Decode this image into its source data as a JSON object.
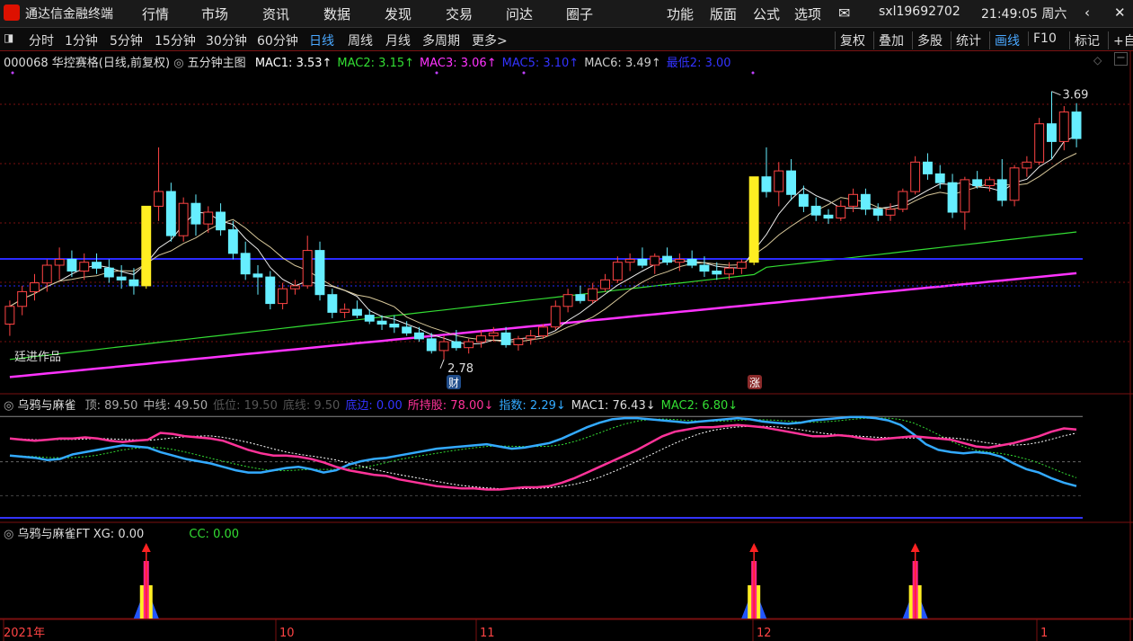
{
  "app": {
    "title": "通达信金融终端",
    "menu": [
      "行情",
      "市场",
      "资讯",
      "数据",
      "发现",
      "交易",
      "问达",
      "圈子"
    ],
    "right_menu": [
      "功能",
      "版面",
      "公式",
      "选项"
    ],
    "user": "sxl19692702",
    "clock": "21:49:05 周六"
  },
  "toolbar": {
    "periods": [
      "分时",
      "1分钟",
      "5分钟",
      "15分钟",
      "30分钟",
      "60分钟",
      "日线",
      "周线",
      "月线",
      "多周期",
      "更多>"
    ],
    "active": "日线",
    "right": [
      "复权",
      "叠加",
      "多股",
      "统计",
      "画线",
      "F10",
      "标记",
      "+自"
    ]
  },
  "main_panel": {
    "stock": "000068 华控赛格(日线,前复权)",
    "indicator": "五分钟主图",
    "values": [
      {
        "label": "MAC1: 3.53↑",
        "color": "#ffffff"
      },
      {
        "label": "MAC2: 3.15↑",
        "color": "#33dd33"
      },
      {
        "label": "MAC3: 3.06↑",
        "color": "#ff33ff"
      },
      {
        "label": "MAC5: 3.10↑",
        "color": "#3333ff"
      },
      {
        "label": "MAC6: 3.49↑",
        "color": "#cccccc"
      },
      {
        "label": "最低2: 3.00",
        "color": "#3333ff"
      }
    ],
    "high_label": "3.69",
    "low_label": "2.78",
    "watermark_note": "廷进作品",
    "marker_cai": "财",
    "marker_zhang": "涨"
  },
  "panel2": {
    "name": "乌鸦与麻雀",
    "values": [
      {
        "label": "顶: 89.50",
        "color": "#aaaaaa"
      },
      {
        "label": "中线: 49.50",
        "color": "#aaaaaa"
      },
      {
        "label": "低位: 19.50",
        "color": "#555555"
      },
      {
        "label": "底线: 9.50",
        "color": "#555555"
      },
      {
        "label": "底边: 0.00",
        "color": "#3333ff"
      },
      {
        "label": "所持股: 78.00↓",
        "color": "#ff3399"
      },
      {
        "label": "指数: 2.29↓",
        "color": "#33aaff"
      },
      {
        "label": "MAC1: 76.43↓",
        "color": "#dddddd"
      },
      {
        "label": "MAC2: 6.80↓",
        "color": "#33dd33"
      }
    ]
  },
  "panel3": {
    "name": "乌鸦与麻雀FT",
    "xg": "XG: 0.00",
    "cc": "CC: 0.00"
  },
  "date_axis": [
    "2021年",
    "10",
    "11",
    "12",
    "1"
  ],
  "chart_data": {
    "type": "candlestick",
    "stock": "000068 华控赛格",
    "high_marker": 3.69,
    "low_marker": 2.78,
    "candles": [
      [
        2.9,
        2.98,
        2.86,
        2.96
      ],
      [
        2.96,
        3.03,
        2.93,
        3.01
      ],
      [
        3.01,
        3.07,
        2.98,
        3.04
      ],
      [
        3.04,
        3.12,
        3.01,
        3.1
      ],
      [
        3.1,
        3.16,
        3.05,
        3.12
      ],
      [
        3.12,
        3.15,
        3.06,
        3.08
      ],
      [
        3.08,
        3.14,
        3.05,
        3.11
      ],
      [
        3.11,
        3.14,
        3.07,
        3.09
      ],
      [
        3.09,
        3.12,
        3.04,
        3.06
      ],
      [
        3.06,
        3.1,
        3.02,
        3.05
      ],
      [
        3.05,
        3.09,
        3.0,
        3.03
      ],
      [
        3.03,
        3.3,
        3.02,
        3.3
      ],
      [
        3.3,
        3.5,
        3.25,
        3.35
      ],
      [
        3.35,
        3.38,
        3.18,
        3.2
      ],
      [
        3.2,
        3.33,
        3.18,
        3.31
      ],
      [
        3.31,
        3.34,
        3.2,
        3.24
      ],
      [
        3.24,
        3.3,
        3.21,
        3.28
      ],
      [
        3.28,
        3.31,
        3.2,
        3.22
      ],
      [
        3.22,
        3.25,
        3.12,
        3.14
      ],
      [
        3.14,
        3.18,
        3.05,
        3.07
      ],
      [
        3.07,
        3.1,
        3.0,
        3.06
      ],
      [
        3.06,
        3.08,
        2.95,
        2.97
      ],
      [
        2.97,
        3.04,
        2.95,
        3.02
      ],
      [
        3.02,
        3.05,
        3.0,
        3.03
      ],
      [
        3.03,
        3.2,
        3.02,
        3.15
      ],
      [
        3.15,
        3.18,
        2.98,
        3.0
      ],
      [
        3.0,
        3.02,
        2.92,
        2.94
      ],
      [
        2.94,
        2.97,
        2.92,
        2.95
      ],
      [
        2.95,
        2.98,
        2.92,
        2.93
      ],
      [
        2.93,
        2.95,
        2.9,
        2.91
      ],
      [
        2.91,
        2.93,
        2.88,
        2.9
      ],
      [
        2.9,
        2.93,
        2.87,
        2.89
      ],
      [
        2.89,
        2.91,
        2.86,
        2.87
      ],
      [
        2.87,
        2.89,
        2.84,
        2.85
      ],
      [
        2.85,
        2.87,
        2.8,
        2.81
      ],
      [
        2.81,
        2.86,
        2.78,
        2.84
      ],
      [
        2.84,
        2.88,
        2.81,
        2.82
      ],
      [
        2.82,
        2.85,
        2.8,
        2.84
      ],
      [
        2.84,
        2.88,
        2.82,
        2.86
      ],
      [
        2.86,
        2.89,
        2.84,
        2.87
      ],
      [
        2.87,
        2.89,
        2.82,
        2.83
      ],
      [
        2.83,
        2.86,
        2.81,
        2.85
      ],
      [
        2.85,
        2.88,
        2.83,
        2.86
      ],
      [
        2.86,
        2.9,
        2.85,
        2.89
      ],
      [
        2.89,
        2.98,
        2.88,
        2.96
      ],
      [
        2.96,
        3.02,
        2.94,
        3.0
      ],
      [
        3.0,
        3.03,
        2.97,
        2.98
      ],
      [
        2.98,
        3.04,
        2.97,
        3.02
      ],
      [
        3.02,
        3.07,
        3.01,
        3.05
      ],
      [
        3.05,
        3.13,
        3.04,
        3.11
      ],
      [
        3.11,
        3.14,
        3.08,
        3.12
      ],
      [
        3.12,
        3.16,
        3.09,
        3.1
      ],
      [
        3.1,
        3.14,
        3.07,
        3.13
      ],
      [
        3.13,
        3.16,
        3.1,
        3.11
      ],
      [
        3.11,
        3.14,
        3.08,
        3.12
      ],
      [
        3.12,
        3.15,
        3.09,
        3.1
      ],
      [
        3.1,
        3.13,
        3.06,
        3.08
      ],
      [
        3.08,
        3.11,
        3.05,
        3.07
      ],
      [
        3.07,
        3.11,
        3.05,
        3.09
      ],
      [
        3.09,
        3.12,
        3.07,
        3.11
      ],
      [
        3.11,
        3.4,
        3.1,
        3.4
      ],
      [
        3.4,
        3.5,
        3.33,
        3.35
      ],
      [
        3.35,
        3.45,
        3.3,
        3.42
      ],
      [
        3.42,
        3.46,
        3.32,
        3.34
      ],
      [
        3.34,
        3.37,
        3.28,
        3.3
      ],
      [
        3.3,
        3.33,
        3.25,
        3.27
      ],
      [
        3.27,
        3.29,
        3.24,
        3.26
      ],
      [
        3.26,
        3.32,
        3.25,
        3.3
      ],
      [
        3.3,
        3.36,
        3.28,
        3.34
      ],
      [
        3.34,
        3.36,
        3.27,
        3.29
      ],
      [
        3.29,
        3.31,
        3.25,
        3.27
      ],
      [
        3.27,
        3.31,
        3.25,
        3.29
      ],
      [
        3.29,
        3.36,
        3.28,
        3.35
      ],
      [
        3.35,
        3.47,
        3.34,
        3.45
      ],
      [
        3.45,
        3.48,
        3.39,
        3.41
      ],
      [
        3.41,
        3.44,
        3.36,
        3.38
      ],
      [
        3.38,
        3.41,
        3.26,
        3.28
      ],
      [
        3.28,
        3.4,
        3.22,
        3.39
      ],
      [
        3.39,
        3.42,
        3.36,
        3.37
      ],
      [
        3.37,
        3.4,
        3.35,
        3.39
      ],
      [
        3.39,
        3.46,
        3.3,
        3.32
      ],
      [
        3.32,
        3.44,
        3.3,
        3.43
      ],
      [
        3.43,
        3.47,
        3.4,
        3.45
      ],
      [
        3.45,
        3.6,
        3.44,
        3.58
      ],
      [
        3.58,
        3.69,
        3.46,
        3.52
      ],
      [
        3.52,
        3.64,
        3.49,
        3.62
      ],
      [
        3.62,
        3.65,
        3.5,
        3.53
      ]
    ],
    "ma": [
      {
        "name": "MAC1",
        "color": "#ffffff",
        "values": [
          3.53
        ]
      },
      {
        "name": "MAC2",
        "color": "#33dd33",
        "values": [
          3.15
        ]
      },
      {
        "name": "MAC3",
        "color": "#ff33ff",
        "values": [
          3.06
        ]
      },
      {
        "name": "MAC5",
        "color": "#3333ff",
        "values": [
          3.1
        ]
      },
      {
        "name": "MAC6",
        "color": "#cccccc",
        "values": [
          3.49
        ]
      }
    ],
    "lows_line": 3.0,
    "oscillator": {
      "levels": [
        89.5,
        49.5,
        19.5,
        9.5,
        0
      ],
      "所持股": [
        70,
        69,
        68,
        69,
        70,
        70,
        71,
        70,
        68,
        67,
        68,
        69,
        75,
        74,
        72,
        71,
        70,
        68,
        64,
        60,
        57,
        55,
        55,
        54,
        52,
        49,
        45,
        42,
        40,
        38,
        37,
        34,
        32,
        30,
        28,
        27,
        26,
        26,
        25,
        25,
        26,
        27,
        27,
        28,
        31,
        35,
        40,
        45,
        50,
        55,
        60,
        66,
        72,
        76,
        78,
        80,
        80,
        81,
        82,
        81,
        80,
        78,
        76,
        74,
        72,
        72,
        73,
        72,
        70,
        69,
        70,
        71,
        72,
        71,
        70,
        69,
        66,
        63,
        62,
        64,
        66,
        69,
        72,
        76,
        79,
        78
      ],
      "指数": [
        55,
        54,
        53,
        51,
        52,
        56,
        58,
        60,
        62,
        64,
        63,
        62,
        58,
        55,
        52,
        50,
        48,
        45,
        42,
        40,
        40,
        42,
        44,
        45,
        43,
        40,
        42,
        47,
        50,
        52,
        53,
        55,
        57,
        59,
        61,
        62,
        63,
        64,
        65,
        63,
        61,
        62,
        64,
        66,
        70,
        75,
        80,
        84,
        87,
        88,
        88,
        87,
        86,
        85,
        84,
        85,
        86,
        87,
        88,
        87,
        85,
        84,
        83,
        84,
        86,
        87,
        88,
        89,
        89,
        88,
        86,
        82,
        74,
        65,
        60,
        58,
        57,
        58,
        57,
        54,
        48,
        43,
        40,
        35,
        31,
        28
      ]
    },
    "signals": [
      {
        "index": 11,
        "label": "XG"
      },
      {
        "index": 60,
        "label": "XG"
      },
      {
        "index": 73,
        "label": "XG"
      }
    ]
  }
}
